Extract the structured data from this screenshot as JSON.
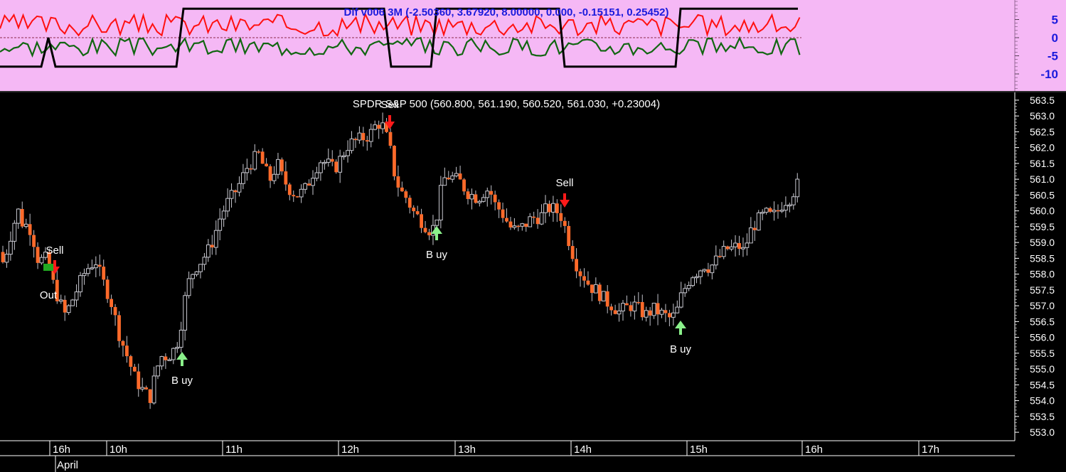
{
  "indicator": {
    "title": "Dif v006 3M (-2.50360, 3.67920, 8.00000, 0.000, -0.15151, 0.25452)",
    "yticks": [
      "5",
      "0",
      "-5",
      "-10"
    ],
    "colors": {
      "background": "#f5b8f5",
      "red": "#ff1010",
      "green": "#116611",
      "black": "#000000",
      "text": "#1a1adc"
    }
  },
  "chart_data": {
    "type": "candlestick",
    "title": "SPDR S&P 500 (560.800, 561.190, 560.520, 561.030, +0.23004)",
    "ylim": [
      552.8,
      563.7
    ],
    "yticks": [
      "563.5",
      "563.0",
      "562.5",
      "562.0",
      "561.5",
      "561.0",
      "560.5",
      "560.0",
      "559.5",
      "559.0",
      "558.5",
      "558.0",
      "557.5",
      "557.0",
      "556.5",
      "556.0",
      "555.5",
      "555.0",
      "554.5",
      "554.0",
      "553.5",
      "553.0"
    ],
    "xticks": [
      "16h",
      "10h",
      "11h",
      "12h",
      "13h",
      "14h",
      "15h",
      "16h",
      "17h"
    ],
    "month_label": "April",
    "colors": {
      "up": "#c8c8d0",
      "down": "#ff6a2a",
      "buy": "#8af08a",
      "sell": "#ff1a1a"
    },
    "signals": [
      {
        "type": "sell",
        "label": "Sell"
      },
      {
        "type": "out",
        "label": "Out"
      },
      {
        "type": "buy",
        "label": "B uy"
      },
      {
        "type": "sell",
        "label": "Sell"
      },
      {
        "type": "buy",
        "label": "B uy"
      },
      {
        "type": "sell",
        "label": "Sell"
      },
      {
        "type": "buy",
        "label": "B uy"
      }
    ]
  }
}
